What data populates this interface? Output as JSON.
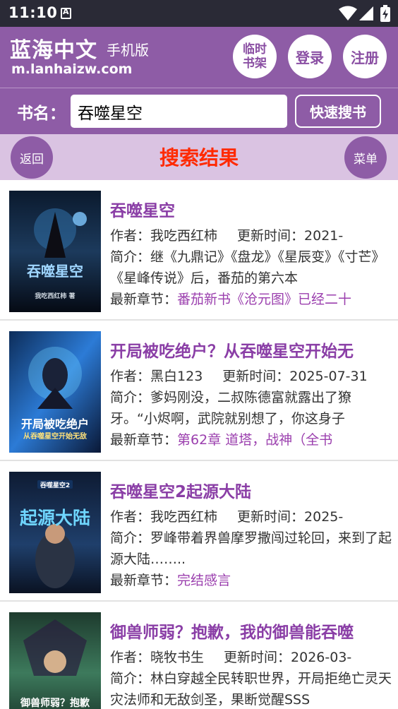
{
  "status": {
    "time": "11:10"
  },
  "header": {
    "site_name": "蓝海中文",
    "site_sub": "手机版",
    "site_url": "m.lanhaizw.com",
    "btn_temp": "临时书架",
    "btn_login": "登录",
    "btn_register": "注册"
  },
  "search": {
    "label": "书名：",
    "value": "吞噬星空",
    "button": "快速搜书"
  },
  "titlebar": {
    "back": "返回",
    "title": "搜索结果",
    "menu": "菜单"
  },
  "labels": {
    "author": "作者：",
    "update": "更新时间：",
    "intro": "简介：",
    "latest": "最新章节："
  },
  "results": [
    {
      "title": "吞噬星空",
      "author": "我吃西红柿",
      "update": "2021-",
      "intro": "继《九鼎记》《盘龙》《星辰变》《寸芒》《星峰传说》后，番茄的第六本",
      "latest": "番茄新书《沧元图》已经二十",
      "cover_text": "吞噬星空",
      "cover_sub": "我吃西红柿 著"
    },
    {
      "title": "开局被吃绝户？从吞噬星空开始无",
      "author": "黑白123",
      "update": "2025-07-31",
      "intro": "爹妈刚没，二叔陈德富就露出了獠牙。“小烬啊，武院就别想了，你这身子",
      "latest": "第62章 道塔，战神（全书",
      "cover_text": "开局被吃绝户",
      "cover_sub": "从吞噬星空开始无敌"
    },
    {
      "title": "吞噬星空2起源大陆",
      "author": "我吃西红柿",
      "update": "2025-",
      "intro": "罗峰带着界兽摩罗撒闯过轮回，来到了起源大陆……..",
      "latest": "完结感言",
      "cover_text": "起源大陆",
      "cover_sub": "吞噬星空2"
    },
    {
      "title": "御兽师弱？抱歉，我的御兽能吞噬",
      "author": "晓牧书生",
      "update": "2026-03-",
      "intro": "林白穿越全民转职世界，开局拒绝亡灵天灾法师和无敌剑圣，果断觉醒SSS",
      "latest": "",
      "cover_text": "御兽师弱？抱歉",
      "cover_sub": ""
    }
  ]
}
